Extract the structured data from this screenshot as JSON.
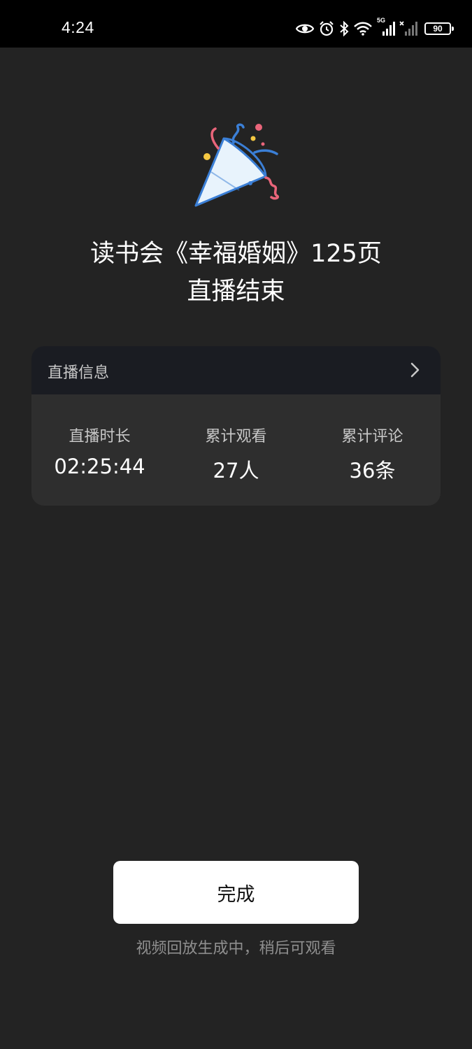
{
  "status_bar": {
    "time": "4:24",
    "network_label": "5G",
    "battery_level": "90",
    "icons": [
      "eye-icon",
      "alarm-icon",
      "bluetooth-icon",
      "wifi-icon",
      "signal-icon",
      "signal-no-service-icon",
      "battery-icon"
    ]
  },
  "celebration": {
    "icon": "party-popper-icon"
  },
  "title": {
    "line1": "读书会《幸福婚姻》125页",
    "line2": "直播结束"
  },
  "info_card": {
    "header_title": "直播信息",
    "header_icon": "chevron-right-icon",
    "stats": [
      {
        "label": "直播时长",
        "value": "02:25:44"
      },
      {
        "label": "累计观看",
        "value": "27人"
      },
      {
        "label": "累计评论",
        "value": "36条"
      }
    ]
  },
  "actions": {
    "done_label": "完成"
  },
  "footnote": "视频回放生成中，稍后可观看",
  "colors": {
    "background": "#232323",
    "status_bar": "#000000",
    "card": "#2e2e2e",
    "card_header": "#1a1c22",
    "button": "#ffffff",
    "muted_text": "#8f8f8f"
  }
}
